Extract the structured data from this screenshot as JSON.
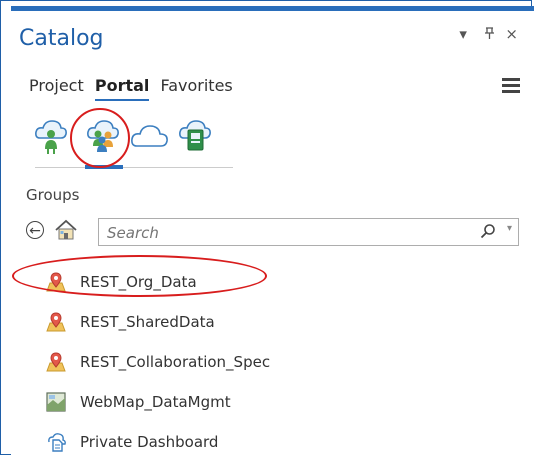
{
  "window": {
    "title": "Catalog",
    "controls": [
      "▾",
      "ᵖ",
      "×"
    ]
  },
  "tabs": [
    {
      "label": "Project",
      "active": false
    },
    {
      "label": "Portal",
      "active": true
    },
    {
      "label": "Favorites",
      "active": false
    }
  ],
  "portal_icons": [
    {
      "name": "my-content-icon",
      "selected": false
    },
    {
      "name": "groups-icon",
      "selected": true
    },
    {
      "name": "all-portal-icon",
      "selected": false
    },
    {
      "name": "living-atlas-icon",
      "selected": false
    }
  ],
  "section": {
    "label": "Groups"
  },
  "search": {
    "placeholder": "Search",
    "value": ""
  },
  "items": [
    {
      "label": "REST_Org_Data",
      "icon": "group-pin-icon",
      "highlighted": true
    },
    {
      "label": "REST_SharedData",
      "icon": "group-pin-icon",
      "highlighted": false
    },
    {
      "label": "REST_Collaboration_Spec",
      "icon": "group-pin-icon",
      "highlighted": false
    },
    {
      "label": "WebMap_DataMgmt",
      "icon": "web-map-icon",
      "highlighted": false
    },
    {
      "label": "Private Dashboard",
      "icon": "dashboard-icon",
      "highlighted": false
    }
  ],
  "colors": {
    "accent": "#2a6ebb",
    "annotation": "#d81d1d"
  }
}
